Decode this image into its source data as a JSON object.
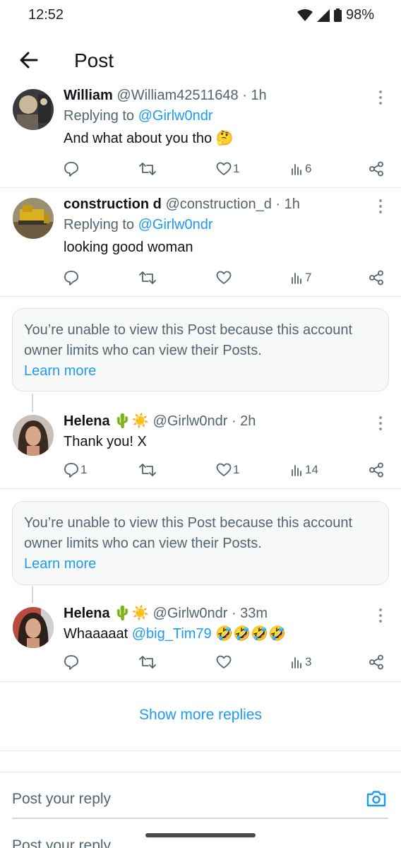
{
  "status_bar": {
    "time": "12:52",
    "battery": "98%",
    "icons": [
      "wifi-icon",
      "signal-icon",
      "battery-icon"
    ]
  },
  "header": {
    "title": "Post",
    "back_icon": "arrow-left-icon"
  },
  "colors": {
    "accent": "#1d9bf0",
    "secondary_text": "#536471",
    "primary_text": "#0f1419",
    "border": "#e6e9eb"
  },
  "tweets": [
    {
      "name": "William",
      "handle": "@William42511648 · 1h",
      "replying_prefix": "Replying to ",
      "replying_to": "@Girlw0ndr",
      "text": "And what about you tho 🤔",
      "replies": "",
      "retweets": "",
      "likes": "1",
      "views": "6"
    },
    {
      "name": "construction d",
      "handle": "@construction_d · 1h",
      "replying_prefix": "Replying to ",
      "replying_to": "@Girlw0ndr",
      "text": "looking good woman",
      "replies": "",
      "retweets": "",
      "likes": "",
      "views": "7"
    },
    {
      "name": "Helena 🌵☀️",
      "handle": "@Girlw0ndr · 2h",
      "text": "Thank you! X",
      "replies": "1",
      "retweets": "",
      "likes": "1",
      "views": "14"
    },
    {
      "name": "Helena 🌵☀️",
      "handle": "@Girlw0ndr · 33m",
      "text_prefix": "Whaaaaat ",
      "text_mention": "@big_Tim79",
      "text_suffix": " 🤣🤣🤣🤣",
      "replies": "",
      "retweets": "",
      "likes": "",
      "views": "3"
    }
  ],
  "notice": {
    "text": "You’re unable to view this Post because this account owner limits who can view their Posts.",
    "link": "Learn more"
  },
  "show_more": "Show more replies",
  "reply": {
    "placeholder": "Post your reply",
    "ghost": "Post your reply"
  }
}
